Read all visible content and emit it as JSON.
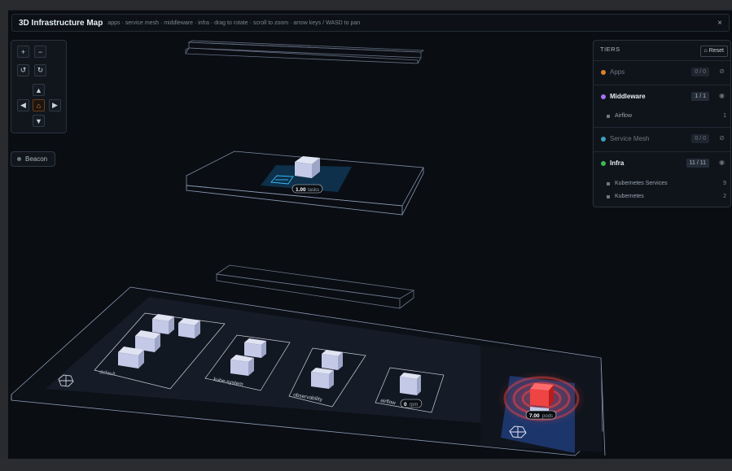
{
  "header": {
    "title": "3D Infrastructure Map",
    "subtitle": "apps · service mesh · middleware · infra · drag to rotate · scroll to zoom · arrow keys / WASD to pan",
    "close_icon": "×"
  },
  "controls": {
    "zoom_in": "+",
    "zoom_out": "−",
    "rotate_left": "↺",
    "rotate_right": "↻",
    "pan_up": "▲",
    "pan_left": "◀",
    "home": "⌂",
    "pan_right": "▶",
    "pan_down": "▼"
  },
  "beacon": {
    "label": "Beacon"
  },
  "tiers": {
    "heading": "TIERS",
    "reset_label": "⌂ Reset",
    "items": [
      {
        "name": "Apps",
        "count": "0 / 0",
        "color": "#d9822b",
        "state": "dim",
        "eye": "⊘"
      },
      {
        "name": "Middleware",
        "count": "1 / 1",
        "color": "#a371f7",
        "state": "active",
        "eye": "◉",
        "children": [
          {
            "name": "Airflow",
            "count": "1"
          }
        ]
      },
      {
        "name": "Service Mesh",
        "count": "0 / 0",
        "color": "#3f9fbf",
        "state": "dim",
        "eye": "⊘"
      },
      {
        "name": "Infra",
        "count": "11 / 11",
        "color": "#3fb950",
        "state": "active",
        "eye": "◉",
        "children": [
          {
            "name": "Kubernetes Services",
            "count": "9"
          },
          {
            "name": "Kubernetes",
            "count": "2"
          }
        ]
      }
    ]
  },
  "scene": {
    "middleware_badge_value": "1.00",
    "middleware_badge_unit": "tasks",
    "namespaces": [
      "default",
      "kube-system",
      "observability",
      "airflow"
    ],
    "airflow_badge_value": "0",
    "airflow_badge_unit": "rpm",
    "cluster_badge_value": "7.00",
    "cluster_badge_unit": "pods",
    "colors": {
      "node": "#c3c9e6",
      "alert": "#ef4444",
      "grid": "#7a8aa6",
      "accent": "#38bdf8"
    }
  }
}
